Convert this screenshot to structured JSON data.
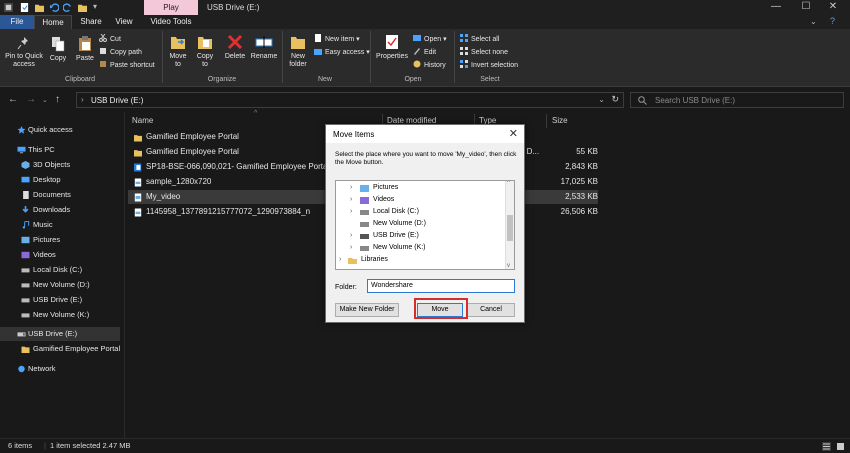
{
  "titlebar": {
    "play_tab": "Play",
    "window_title": "USB Drive (E:)",
    "controls": {
      "minimize": "—",
      "maximize": "☐",
      "close": "✕"
    }
  },
  "tabs": [
    "File",
    "Home",
    "Share",
    "View",
    "Video Tools"
  ],
  "ribbon": {
    "pin_to_quick_access": "Pin to Quick access",
    "copy": "Copy",
    "paste": "Paste",
    "cut": "Cut",
    "copy_path": "Copy path",
    "paste_shortcut": "Paste shortcut",
    "clipboard_group": "Clipboard",
    "move_to": "Move to",
    "copy_to": "Copy to",
    "delete": "Delete",
    "rename": "Rename",
    "organize_group": "Organize",
    "new_folder": "New folder",
    "new_item": "New item ▾",
    "easy_access": "Easy access ▾",
    "new_group": "New",
    "properties": "Properties",
    "open": "Open ▾",
    "edit": "Edit",
    "history": "History",
    "open_group": "Open",
    "select_all": "Select all",
    "select_none": "Select none",
    "invert_selection": "Invert selection",
    "select_group": "Select"
  },
  "address": {
    "path": "USB Drive (E:)",
    "search_placeholder": "Search USB Drive (E:)"
  },
  "nav": [
    {
      "label": "Quick access",
      "icon": "star-icon"
    },
    {
      "label": "This PC",
      "icon": "pc-icon"
    },
    {
      "label": "3D Objects",
      "icon": "cube-icon"
    },
    {
      "label": "Desktop",
      "icon": "desktop-icon"
    },
    {
      "label": "Documents",
      "icon": "documents-icon"
    },
    {
      "label": "Downloads",
      "icon": "download-icon"
    },
    {
      "label": "Music",
      "icon": "music-icon"
    },
    {
      "label": "Pictures",
      "icon": "pictures-icon"
    },
    {
      "label": "Videos",
      "icon": "videos-icon"
    },
    {
      "label": "Local Disk (C:)",
      "icon": "drive-icon"
    },
    {
      "label": "New Volume (D:)",
      "icon": "drive-icon"
    },
    {
      "label": "USB Drive (E:)",
      "icon": "drive-icon"
    },
    {
      "label": "New Volume (K:)",
      "icon": "drive-icon"
    },
    {
      "label": "USB Drive (E:)",
      "icon": "usb-icon"
    },
    {
      "label": "Gamified Employee Portal",
      "icon": "folder-icon"
    },
    {
      "label": "Network",
      "icon": "network-icon"
    }
  ],
  "columns": [
    "Name",
    "Date modified",
    "Type",
    "Size"
  ],
  "files": [
    {
      "name": "Gamified Employee Portal",
      "type": "",
      "size": "",
      "icon": "folder-icon"
    },
    {
      "name": "Gamified Employee Portal",
      "type": "d D...",
      "size": "55 KB",
      "icon": "folder-icon"
    },
    {
      "name": "SP18-BSE-066,090,021- Gamified Employee Portal - FYP",
      "type": "",
      "size": "2,843 KB",
      "icon": "word-icon"
    },
    {
      "name": "sample_1280x720",
      "type": "",
      "size": "17,025 KB",
      "icon": "file-icon"
    },
    {
      "name": "My_video",
      "type": "",
      "size": "2,533 KB",
      "icon": "video-file-icon"
    },
    {
      "name": "1145958_1377891215777072_1290973884_n",
      "type": "",
      "size": "26,506 KB",
      "icon": "file-icon"
    }
  ],
  "status": {
    "items": "6 items",
    "selected": "1 item selected  2.47 MB"
  },
  "dialog": {
    "title": "Move Items",
    "close": "✕",
    "instruction": "Select the place where you want to move 'My_video', then click the Move button.",
    "tree": [
      {
        "label": "Pictures",
        "icon": "pictures-icon",
        "chevron": "›"
      },
      {
        "label": "Videos",
        "icon": "videos-icon",
        "chevron": "›"
      },
      {
        "label": "Local Disk (C:)",
        "icon": "drive-icon",
        "chevron": "›"
      },
      {
        "label": "New Volume (D:)",
        "icon": "drive-icon",
        "chevron": ""
      },
      {
        "label": "USB Drive (E:)",
        "icon": "usb-icon",
        "chevron": "›"
      },
      {
        "label": "New Volume (K:)",
        "icon": "drive-icon",
        "chevron": "›"
      },
      {
        "label": "Libraries",
        "icon": "library-icon",
        "chevron": "›"
      }
    ],
    "folder_label": "Folder:",
    "folder_value": "Wondershare",
    "new_folder_btn": "Make New Folder",
    "move_btn": "Move",
    "cancel_btn": "Cancel"
  }
}
